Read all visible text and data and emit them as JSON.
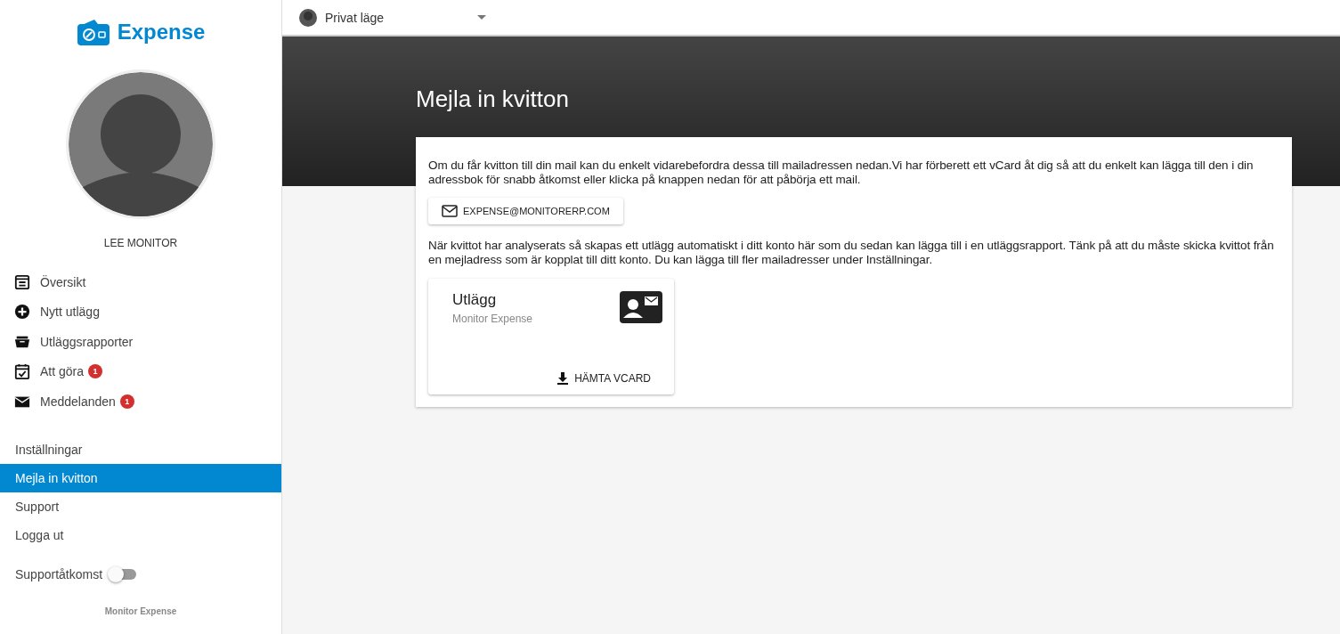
{
  "brand": {
    "name": "Expense"
  },
  "user": {
    "name": "LEE MONITOR"
  },
  "nav": [
    {
      "label": "Översikt"
    },
    {
      "label": "Nytt utlägg"
    },
    {
      "label": "Utläggsrapporter"
    },
    {
      "label": "Att göra",
      "badge": "1"
    },
    {
      "label": "Meddelanden",
      "badge": "1"
    }
  ],
  "links": [
    {
      "label": "Inställningar",
      "selected": false
    },
    {
      "label": "Mejla in kvitton",
      "selected": true
    },
    {
      "label": "Support",
      "selected": false
    },
    {
      "label": "Logga ut",
      "selected": false
    }
  ],
  "support_access": {
    "label": "Supportåtkomst",
    "on": false
  },
  "footer": "Monitor Expense",
  "mode_select": {
    "value": "Privat läge"
  },
  "page": {
    "title": "Mejla in kvitton",
    "intro": "Om du får kvitton till din mail kan du enkelt vidarebefordra dessa till mailadressen nedan.Vi har förberett ett vCard åt dig så att du enkelt kan lägga till den i din adressbok för snabb åtkomst eller klicka på knappen nedan för att påbörja ett mail.",
    "email_button": "EXPENSE@MONITORERP.COM",
    "info": "När kvittot har analyserats så skapas ett utlägg automatiskt i ditt konto här som du sedan kan lägga till i en utläggsrapport. Tänk på att du måste skicka kvittot från en mejladress som är kopplat till ditt konto. Du kan lägga till fler mailadresser under Inställningar.",
    "vcard": {
      "title": "Utlägg",
      "subtitle": "Monitor Expense",
      "button": "HÄMTA VCARD"
    }
  }
}
